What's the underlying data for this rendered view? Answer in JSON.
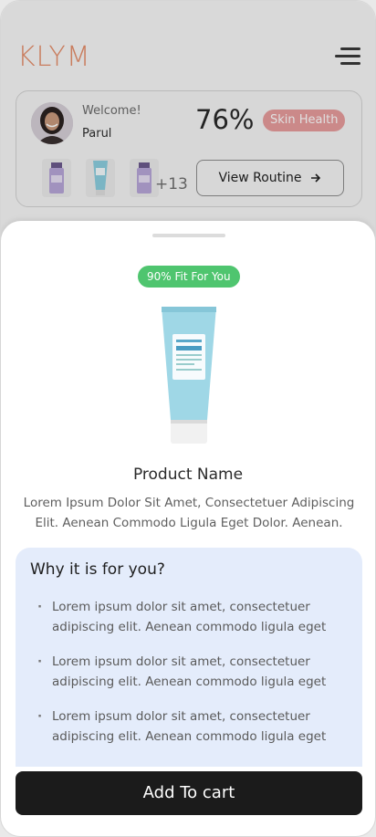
{
  "brand": {
    "logo": "KLYM",
    "accent_color": "#e58f6c"
  },
  "header": {
    "menu_icon": "hamburger-menu-icon"
  },
  "profile": {
    "welcome": "Welcome!",
    "name": "Parul",
    "health_percent": "76%",
    "health_label": "Skin Health",
    "extra_products_count": "+13",
    "routine_button": "View Routine",
    "routine_icon": "arrow-right-icon"
  },
  "sheet": {
    "fit_badge": "90% Fit For You",
    "product_name": "Product Name",
    "product_description": "Lorem Ipsum Dolor Sit Amet, Consectetuer Adipiscing Elit. Aenean Commodo Ligula Eget Dolor. Aenean.",
    "why_title": "Why it is for you?",
    "reasons": [
      "Lorem ipsum dolor sit amet, consectetuer adipiscing elit. Aenean commodo ligula eget",
      "Lorem ipsum dolor sit amet, consectetuer adipiscing elit. Aenean commodo ligula eget",
      "Lorem ipsum dolor sit amet, consectetuer adipiscing elit. Aenean commodo ligula eget"
    ],
    "cart_button": "Add To cart"
  }
}
